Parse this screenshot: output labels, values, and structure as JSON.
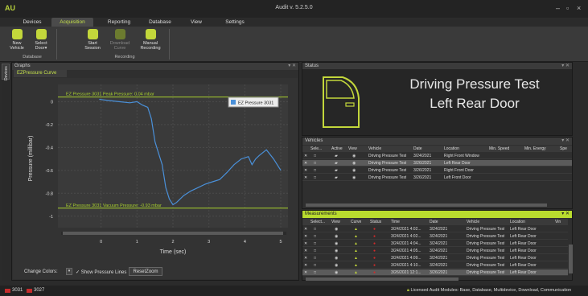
{
  "app": {
    "logo": "AU",
    "title": "Audit v. 5.2.5.0",
    "win_min": "–",
    "win_max": "▫",
    "win_close": "×"
  },
  "tabs": [
    "Devices",
    "Acquisition",
    "Reporting",
    "Database",
    "View",
    "Settings"
  ],
  "ribbon": {
    "buttons": [
      {
        "label": "New\nVehicle",
        "icon": "car-add-icon"
      },
      {
        "label": "Select\nDoor▾",
        "icon": "door-icon"
      },
      {
        "label": "Start\nSession",
        "icon": "play-icon"
      },
      {
        "label": "Download\nCurve",
        "icon": "download-icon",
        "disabled": true
      },
      {
        "label": "Manual\nRecording",
        "icon": "record-icon"
      }
    ],
    "groups": [
      "Database",
      "Recording"
    ]
  },
  "sidetab": "Devices",
  "graphs": {
    "title": "Graphs",
    "tab": "EZPressure Curve",
    "legend": "EZ Pressure 3031",
    "change_colors": "Change Colors:",
    "show_lines": "Show Pressure Lines",
    "reset_zoom": "ResetZoom",
    "peak_label": "EZ Pressure 3031 Peak Pressure: 0.04 mbar",
    "vac_label": "EZ Pressure 3031 Vacuum Pressure: -0.93 mbar"
  },
  "chart_data": {
    "type": "line",
    "xlabel": "Time (sec)",
    "ylabel": "Pressure (millibar)",
    "xlim": [
      -1.2,
      5.2
    ],
    "ylim": [
      -1.1,
      0.15
    ],
    "xticks": [
      "0",
      "1",
      "2",
      "3",
      "4",
      "5"
    ],
    "yticks": [
      "0",
      "-0.2",
      "-0.4",
      "-0.6",
      "-0.8",
      "-1"
    ],
    "peak": 0.04,
    "vacuum": -0.93,
    "series": [
      {
        "name": "EZ Pressure 3031",
        "color": "#4a90d9",
        "x": [
          -0.05,
          0.2,
          0.5,
          0.8,
          1.0,
          1.15,
          1.3,
          1.4,
          1.5,
          1.6,
          1.7,
          1.8,
          1.9,
          2.0,
          2.1,
          2.3,
          2.5,
          2.7,
          2.9,
          3.1,
          3.3,
          3.5,
          3.7,
          3.9,
          4.1,
          4.2,
          4.3,
          4.4,
          4.6,
          4.8,
          4.9,
          5.0
        ],
        "y": [
          0.02,
          0.01,
          0.0,
          -0.01,
          0.0,
          -0.03,
          -0.05,
          -0.15,
          -0.35,
          -0.45,
          -0.55,
          -0.75,
          -0.85,
          -0.9,
          -0.88,
          -0.82,
          -0.78,
          -0.75,
          -0.72,
          -0.7,
          -0.68,
          -0.62,
          -0.55,
          -0.5,
          -0.48,
          -0.55,
          -0.5,
          -0.47,
          -0.42,
          -0.5,
          -0.55,
          -0.6
        ]
      }
    ]
  },
  "status": {
    "title": "Status",
    "line1": "Driving Pressure Test",
    "line2": "Left Rear Door"
  },
  "vehicles": {
    "title": "Vehicles",
    "headers": [
      "Sele...",
      "Active",
      "View",
      "Vehicle",
      "Date",
      "Location",
      "Min. Speed",
      "Min. Energy",
      "Spe"
    ],
    "rows": [
      [
        "Driving Pressure Test",
        "3/24/2021",
        "Right Front Window"
      ],
      [
        "Driving Pressure Test",
        "3/26/2021",
        "Left Rear Door"
      ],
      [
        "Driving Pressure Test",
        "3/26/2021",
        "Right Front Door"
      ],
      [
        "Driving Pressure Test",
        "3/26/2021",
        "Left Front Door"
      ]
    ]
  },
  "measurements": {
    "title": "Measurements",
    "headers": [
      "Select...",
      "View",
      "Curve",
      "Status",
      "Time",
      "Date",
      "Vehicle",
      "Location",
      "Vin"
    ],
    "rows": [
      [
        "3/24/2021 4:02...",
        "3/24/2021",
        "Driving Pressure Test",
        "Left Rear Door"
      ],
      [
        "3/24/2021 4:02...",
        "3/24/2021",
        "Driving Pressure Test",
        "Left Rear Door"
      ],
      [
        "3/24/2021 4:04...",
        "3/24/2021",
        "Driving Pressure Test",
        "Left Rear Door"
      ],
      [
        "3/24/2021 4:05...",
        "3/24/2021",
        "Driving Pressure Test",
        "Left Rear Door"
      ],
      [
        "3/24/2021 4:09...",
        "3/24/2021",
        "Driving Pressure Test",
        "Left Rear Door"
      ],
      [
        "3/24/2021 4:10...",
        "3/24/2021",
        "Driving Pressure Test",
        "Left Rear Door"
      ],
      [
        "3/26/2021 12:1...",
        "3/26/2021",
        "Driving Pressure Test",
        "Left Rear Door"
      ]
    ]
  },
  "footer": {
    "dev1": "3031",
    "dev2": "3027",
    "license": "Licensed Audit Modules: Base, Database, Multidevice, Download, Communication"
  },
  "colors": {
    "accent": "#c3d73b",
    "curve": "#4a90d9",
    "alarm": "#d42a2a"
  }
}
